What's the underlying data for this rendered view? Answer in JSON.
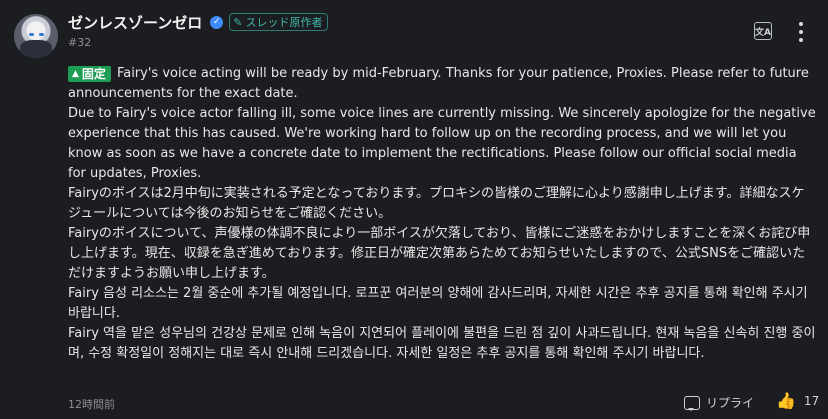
{
  "post": {
    "author": "ゼンレスゾーンゼロ",
    "op_badge": "スレッド原作者",
    "post_number": "#32",
    "pinned_label": "固定",
    "paragraphs": [
      "Fairy's voice acting will be ready by mid-February. Thanks for your patience, Proxies. Please refer to future announcements for the exact date.",
      "Due to Fairy's voice actor falling ill, some voice lines are currently missing. We sincerely apologize for the negative experience that this has caused. We're working hard to follow up on the recording process, and we will let you know as soon as we have a concrete date to implement the rectifications. Please follow our official social media for updates, Proxies.",
      "Fairyのボイスは2月中旬に実装される予定となっております。プロキシの皆様のご理解に心より感謝申し上げます。詳細なスケジュールについては今後のお知らせをご確認ください。",
      "Fairyのボイスについて、声優様の体調不良により一部ボイスが欠落しており、皆様にご迷惑をおかけしますことを深くお詫び申し上げます。現在、収録を急ぎ進めております。修正日が確定次第あらためてお知らせいたしますので、公式SNSをご確認いただけますようお願い申し上げます。",
      "Fairy 음성 리소스는 2월 중순에 추가될 예정입니다. 로프꾼 여러분의 양해에 감사드리며, 자세한 시간은 추후 공지를 통해 확인해 주시기 바랍니다.",
      "Fairy 역을 맡은 성우님의 건강상 문제로 인해 녹음이 지연되어 플레이에 불편을 드린 점 깊이 사과드립니다. 현재 녹음을 신속히 진행 중이며, 수정 확정일이 정해지는 대로 즉시 안내해 드리겠습니다. 자세한 일정은 추후 공지를 통해 확인해 주시기 바랍니다."
    ],
    "timestamp": "12時間前",
    "reply_label": "リプライ",
    "like_count": "17"
  },
  "icons": {
    "verified": "verified-badge-icon",
    "translate": "translate-icon",
    "more": "more-vertical-icon",
    "reply": "reply-icon",
    "like": "thumbs-up-icon",
    "pin": "pin-icon"
  },
  "colors": {
    "background": "#1c1d21",
    "pinned_badge": "#1f9d55",
    "op_badge": "#3fb9a8",
    "verified": "#3d8bfd"
  }
}
